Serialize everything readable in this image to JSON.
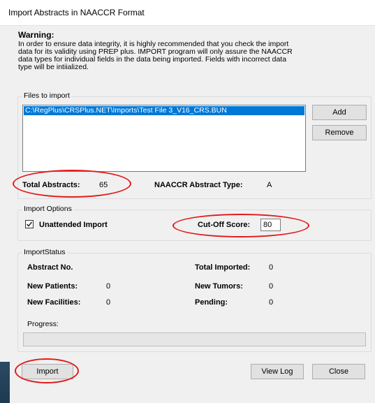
{
  "window": {
    "title": "Import Abstracts in NAACCR Format"
  },
  "warning": {
    "heading": "Warning:",
    "lines": [
      "In order to ensure data integrity, it is highly recommended that you check the import",
      "data for its validity using PREP plus.   IMPORT program will only assure the NAACCR",
      "data types for individual fields in the data being imported.  Fields with incorrect data",
      "type will be intiialized."
    ]
  },
  "files": {
    "group_label": "Files to import",
    "items": [
      "C:\\RegPlus\\CRSPlus.NET\\Imports\\Test File 3_V16_CRS.BUN"
    ],
    "add_label": "Add",
    "remove_label": "Remove",
    "total_abstracts_label": "Total Abstracts:",
    "total_abstracts_value": "65",
    "abstract_type_label": "NAACCR Abstract Type:",
    "abstract_type_value": "A"
  },
  "options": {
    "group_label": "Import Options",
    "unattended_label": "Unattended Import",
    "unattended_checked": true,
    "cutoff_label": "Cut-Off Score:",
    "cutoff_value": "80"
  },
  "status": {
    "group_label": "ImportStatus",
    "abstract_no_label": "Abstract No.",
    "total_imported_label": "Total Imported:",
    "total_imported_value": "0",
    "new_patients_label": "New Patients:",
    "new_patients_value": "0",
    "new_tumors_label": "New Tumors:",
    "new_tumors_value": "0",
    "new_facilities_label": "New Facilities:",
    "new_facilities_value": "0",
    "pending_label": "Pending:",
    "pending_value": "0",
    "progress_label": "Progress:",
    "progress_value": 0
  },
  "buttons": {
    "import_label": "Import",
    "view_log_label": "View Log",
    "close_label": "Close"
  },
  "colors": {
    "selection": "#0078d7",
    "annotation": "#e21a1a"
  }
}
